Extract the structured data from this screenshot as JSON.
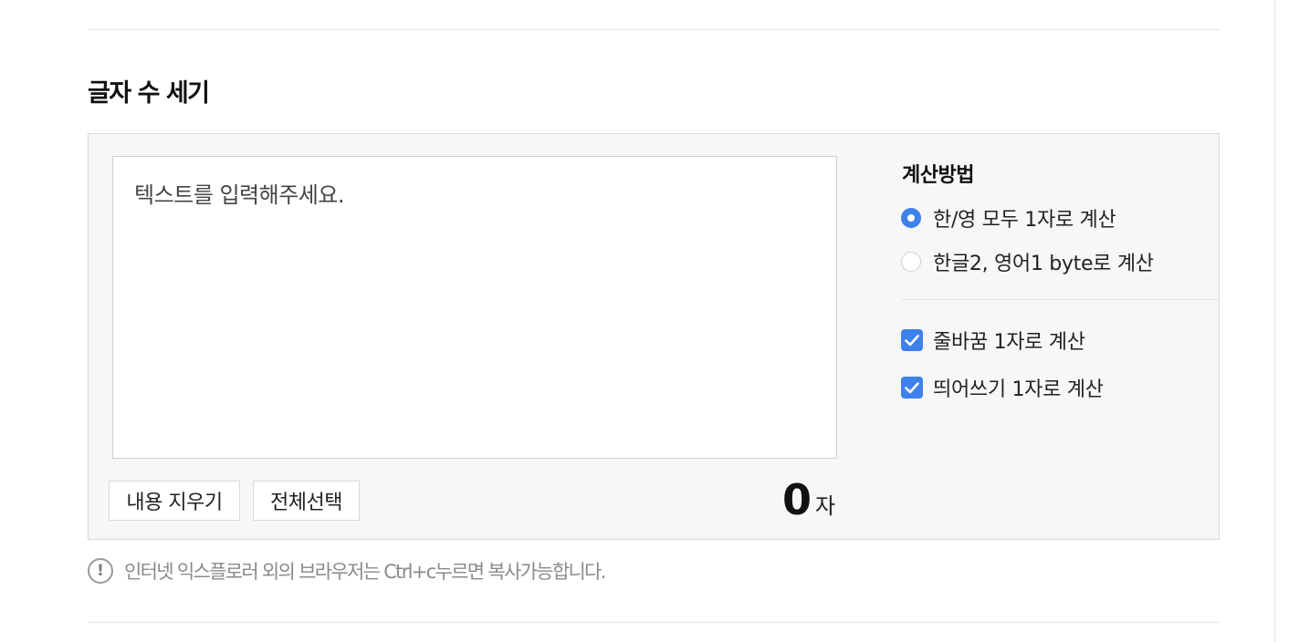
{
  "section": {
    "title": "글자 수 세기"
  },
  "editor": {
    "placeholder": "텍스트를 입력해주세요.",
    "value": ""
  },
  "buttons": {
    "clear_label": "내용 지우기",
    "select_all_label": "전체선택"
  },
  "counter": {
    "value": "0",
    "unit": "자"
  },
  "options": {
    "heading": "계산방법",
    "radios": [
      {
        "label": "한/영 모두 1자로 계산",
        "selected": true
      },
      {
        "label": "한글2, 영어1 byte로 계산",
        "selected": false
      }
    ],
    "checkboxes": [
      {
        "label": "줄바꿈 1자로 계산",
        "checked": true
      },
      {
        "label": "띄어쓰기 1자로 계산",
        "checked": true
      }
    ]
  },
  "notice": {
    "icon": "exclamation-icon",
    "text": "인터넷 익스플로러 외의 브라우저는 Ctrl+c누르면 복사가능합니다."
  },
  "colors": {
    "accent": "#3e80ec",
    "panel_bg": "#f7f7f7",
    "border": "#d9d9d9",
    "notice_text": "#8a8a8a"
  }
}
